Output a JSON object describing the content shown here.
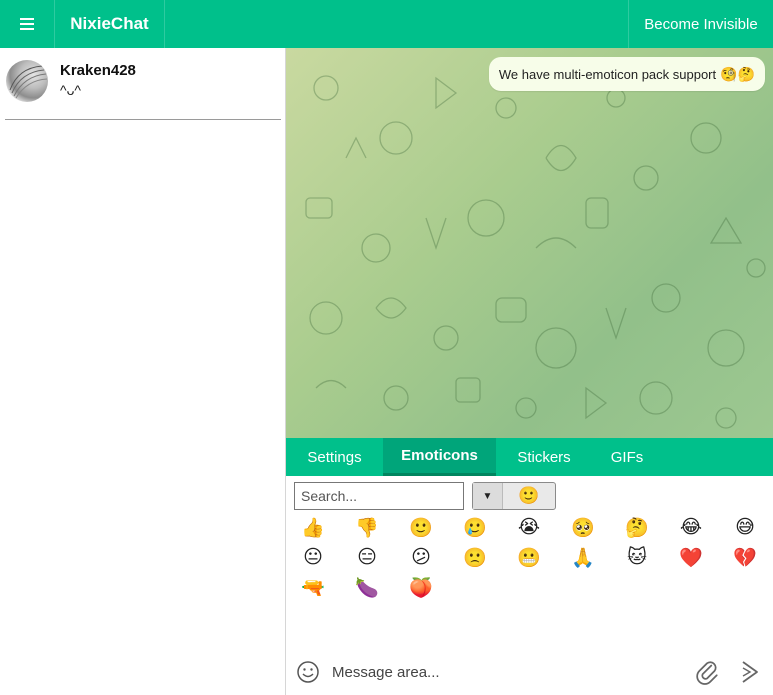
{
  "topbar": {
    "menu_icon": "hamburger-icon",
    "brand": "NixieChat",
    "invisible_label": "Become Invisible"
  },
  "sidebar": {
    "contacts": [
      {
        "name": "Kraken428",
        "status": "^ᴗ^"
      }
    ]
  },
  "chat": {
    "messages": [
      {
        "text": "We have multi-emoticon pack support",
        "emojis": "🧐🤔"
      }
    ]
  },
  "tabs": [
    {
      "label": "Settings",
      "active": false
    },
    {
      "label": "Emoticons",
      "active": true
    },
    {
      "label": "Stickers",
      "active": false
    },
    {
      "label": "GIFs",
      "active": false
    }
  ],
  "emoticons": {
    "search_placeholder": "Search...",
    "selected_pack": "🙂",
    "items": [
      "👍",
      "👎",
      "🙂",
      "🥲",
      "😭",
      "🥺",
      "🤔",
      "😂",
      "😅",
      "😐",
      "😑",
      "😕",
      "🙁",
      "😬",
      "🙏",
      "🐱",
      "❤️",
      "💔",
      "🔫",
      "🍆",
      "🍑"
    ]
  },
  "compose": {
    "placeholder": "Message area..."
  },
  "colors": {
    "accent": "#00c08b",
    "tab_active": "#00a57a",
    "bubble": "#f7fde9"
  }
}
